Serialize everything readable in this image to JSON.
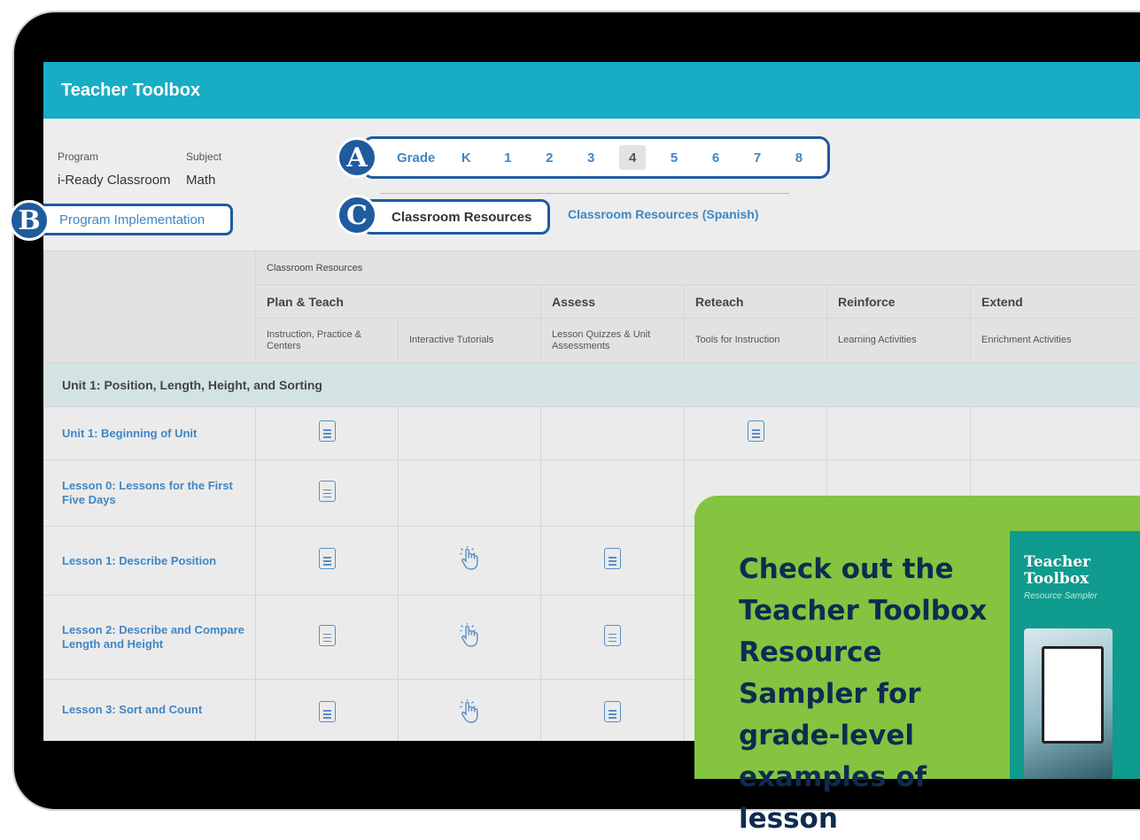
{
  "app": {
    "title": "Teacher Toolbox"
  },
  "meta": {
    "program_label": "Program",
    "program_value": "i-Ready Classroom",
    "subject_label": "Subject",
    "subject_value": "Math",
    "implementation_link": "Program Implementation"
  },
  "badges": {
    "a": "A",
    "b": "B",
    "c": "C"
  },
  "grades": {
    "label": "Grade",
    "items": [
      "K",
      "1",
      "2",
      "3",
      "4",
      "5",
      "6",
      "7",
      "8"
    ],
    "selected": "4"
  },
  "tabs": {
    "active": "Classroom Resources",
    "other": "Classroom Resources (Spanish)"
  },
  "table": {
    "super_header": "Classroom Resources",
    "categories": [
      "Plan & Teach",
      "Assess",
      "Reteach",
      "Reinforce",
      "Extend"
    ],
    "subheaders": [
      "Instruction, Practice & Centers",
      "Interactive Tutorials",
      "Lesson Quizzes & Unit Assessments",
      "Tools for Instruction",
      "Learning Activities",
      "Enrichment Activities"
    ],
    "unit_title": "Unit 1: Position, Length, Height, and Sorting",
    "rows": [
      {
        "name": "Unit 1: Beginning of Unit"
      },
      {
        "name": "Lesson 0: Lessons for the First Five Days"
      },
      {
        "name": "Lesson 1: Describe Position"
      },
      {
        "name": "Lesson 2: Describe and Compare Length and Height"
      },
      {
        "name": "Lesson 3: Sort and Count"
      }
    ]
  },
  "icons": {
    "document": "document-icon",
    "interactive": "tap-hand-icon"
  },
  "promo": {
    "text": "Check out the Teacher Toolbox Resource Sampler for grade-level examples of lesson",
    "cover_title": "Teacher Toolbox",
    "cover_subtitle": "Resource Sampler"
  },
  "colors": {
    "header": "#17adc5",
    "accent_blue": "#1f5b9e",
    "link_blue": "#3f87c6",
    "unit_row": "#d3e3e3",
    "promo_green": "#84c440",
    "cover_teal": "#0f9b8e"
  }
}
